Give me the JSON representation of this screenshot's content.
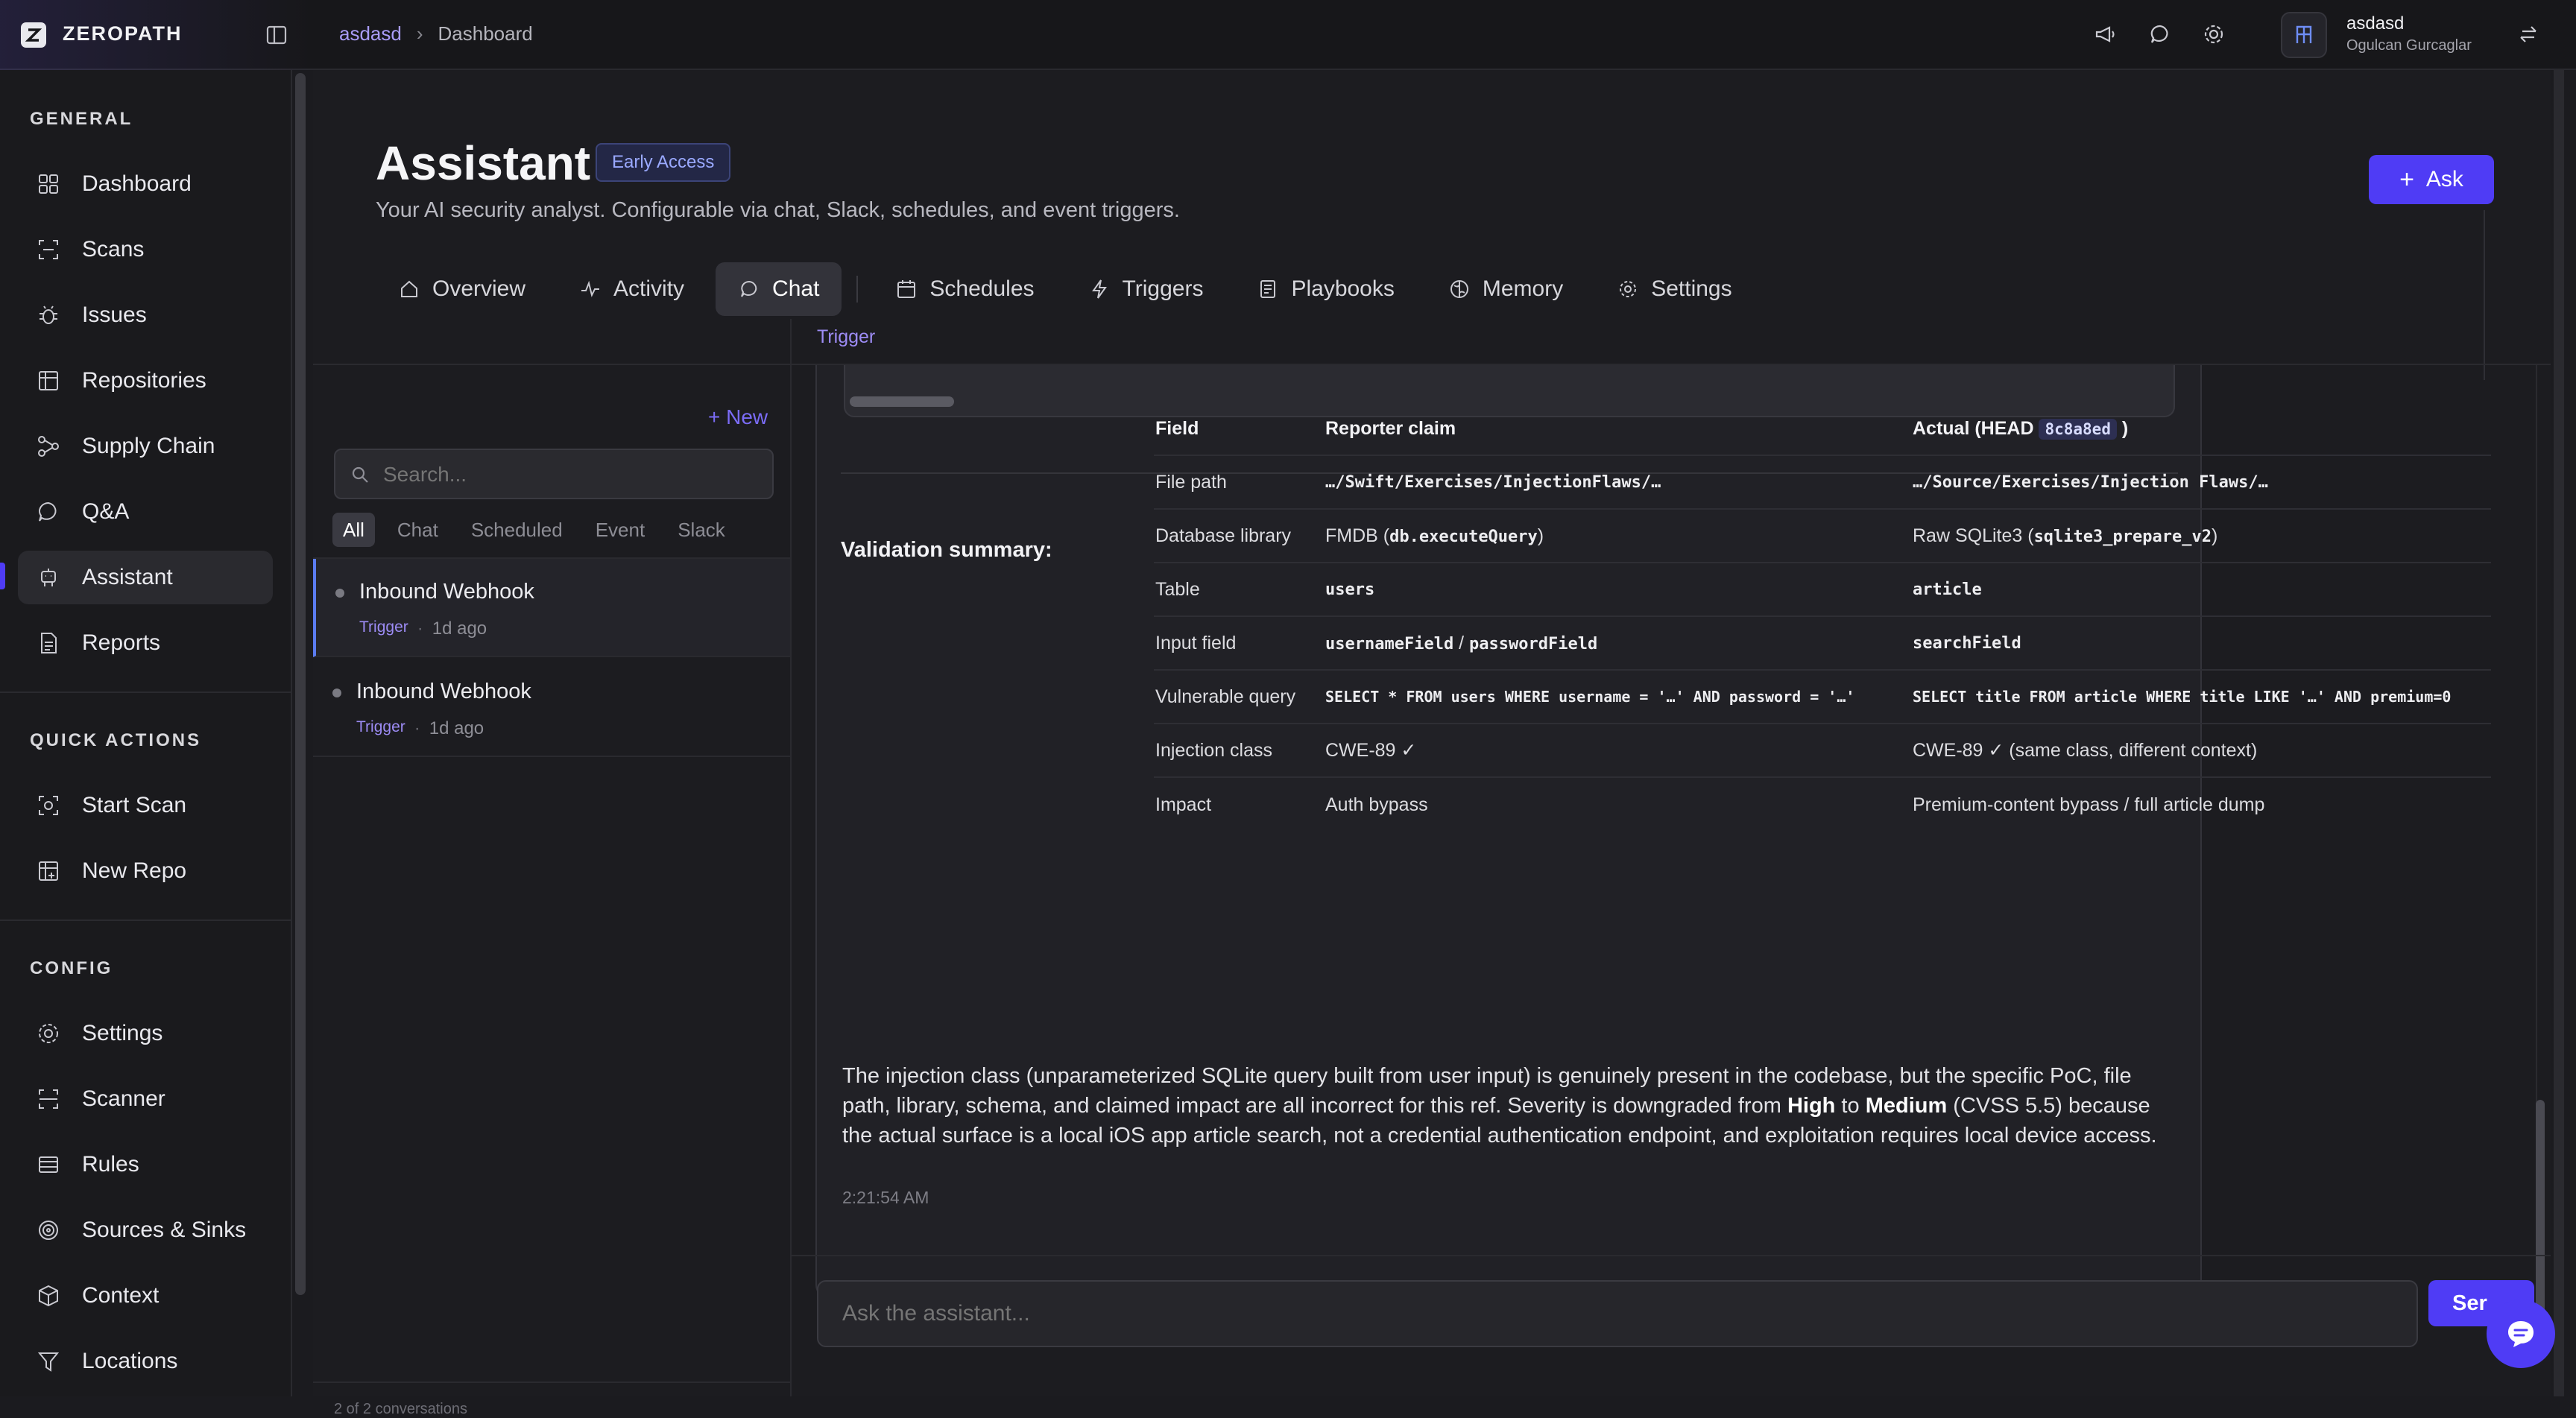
{
  "brand": {
    "name": "ZEROPATH"
  },
  "breadcrumb": {
    "org": "asdasd",
    "page": "Dashboard"
  },
  "user": {
    "org": "asdasd",
    "name": "Ogulcan Gurcaglar"
  },
  "sidebar": {
    "general_title": "GENERAL",
    "general": [
      {
        "label": "Dashboard",
        "icon": "grid-icon"
      },
      {
        "label": "Scans",
        "icon": "scan-icon"
      },
      {
        "label": "Issues",
        "icon": "bug-icon"
      },
      {
        "label": "Repositories",
        "icon": "table-icon"
      },
      {
        "label": "Supply Chain",
        "icon": "nodes-icon"
      },
      {
        "label": "Q&A",
        "icon": "chat-bubble-icon"
      },
      {
        "label": "Assistant",
        "icon": "bot-icon"
      },
      {
        "label": "Reports",
        "icon": "report-icon"
      }
    ],
    "quick_title": "QUICK ACTIONS",
    "quick": [
      {
        "label": "Start Scan",
        "icon": "scan-start-icon"
      },
      {
        "label": "New Repo",
        "icon": "add-table-icon"
      }
    ],
    "config_title": "CONFIG",
    "config": [
      {
        "label": "Settings",
        "icon": "gear-icon"
      },
      {
        "label": "Scanner",
        "icon": "scanner-icon"
      },
      {
        "label": "Rules",
        "icon": "rules-icon"
      },
      {
        "label": "Sources & Sinks",
        "icon": "target-icon"
      },
      {
        "label": "Context",
        "icon": "box-icon"
      },
      {
        "label": "Locations",
        "icon": "filter-icon"
      }
    ]
  },
  "header": {
    "title": "Assistant",
    "badge": "Early Access",
    "subtitle": "Your AI security analyst. Configurable via chat, Slack, schedules, and event triggers.",
    "ask_label": "Ask"
  },
  "tabs": [
    {
      "label": "Overview"
    },
    {
      "label": "Activity"
    },
    {
      "label": "Chat"
    },
    {
      "label": "Schedules"
    },
    {
      "label": "Triggers"
    },
    {
      "label": "Playbooks"
    },
    {
      "label": "Memory"
    },
    {
      "label": "Settings"
    }
  ],
  "conversations": {
    "new_label": "+ New",
    "search_placeholder": "Search...",
    "filters": [
      "All",
      "Chat",
      "Scheduled",
      "Event",
      "Slack"
    ],
    "items": [
      {
        "title": "Inbound Webhook",
        "tag": "Trigger",
        "sep": "·",
        "time": "1d ago"
      },
      {
        "title": "Inbound Webhook",
        "tag": "Trigger",
        "sep": "·",
        "time": "1d ago"
      }
    ],
    "count": "2 of 2 conversations"
  },
  "chat": {
    "header_tag": "Trigger",
    "summary_title": "Validation summary:",
    "table": {
      "headers": [
        "Field",
        "Reporter claim",
        "Actual (HEAD ",
        "8c8a8ed",
        " )"
      ],
      "rows": [
        {
          "field": "File path",
          "reporter": "…/Swift/Exercises/InjectionFlaws/…",
          "actual": "…/Source/Exercises/Injection Flaws/…"
        },
        {
          "field": "Database library",
          "reporter_pre": "FMDB (",
          "reporter_code": "db.executeQuery",
          "reporter_post": ")",
          "actual_pre": "Raw SQLite3 (",
          "actual_code": "sqlite3_prepare_v2",
          "actual_post": ")"
        },
        {
          "field": "Table",
          "reporter": "users",
          "actual": "article"
        },
        {
          "field": "Input field",
          "reporter_a": "usernameField",
          "reporter_sep": " / ",
          "reporter_b": "passwordField",
          "actual": "searchField"
        },
        {
          "field": "Vulnerable query",
          "reporter": "SELECT * FROM users WHERE username = '…' AND password = '…'",
          "actual": "SELECT title FROM article WHERE title LIKE '…' AND premium=0"
        },
        {
          "field": "Injection class",
          "reporter": "CWE-89 ✓",
          "actual": "CWE-89 ✓ (same class, different context)"
        },
        {
          "field": "Impact",
          "reporter": "Auth bypass",
          "actual": "Premium-content bypass / full article dump"
        }
      ]
    },
    "paragraph": {
      "p1": "The injection class (unparameterized SQLite query built from user input) is genuinely present in the codebase, but the specific PoC, file path, library, schema, and claimed impact are all incorrect for this ref. Severity is downgraded from ",
      "b1": "High",
      "p2": " to ",
      "b2": "Medium",
      "p3": " (CVSS 5.5) because the actual surface is a local iOS app article search, not a credential authentication endpoint, and exploitation requires local device access."
    },
    "timestamp": "2:21:54 AM",
    "input_placeholder": "Ask the assistant...",
    "send_label": "Ser"
  },
  "colors": {
    "accent": "#4f3cf5",
    "tag": "#9d8cf5",
    "link": "#7b6cf6"
  }
}
